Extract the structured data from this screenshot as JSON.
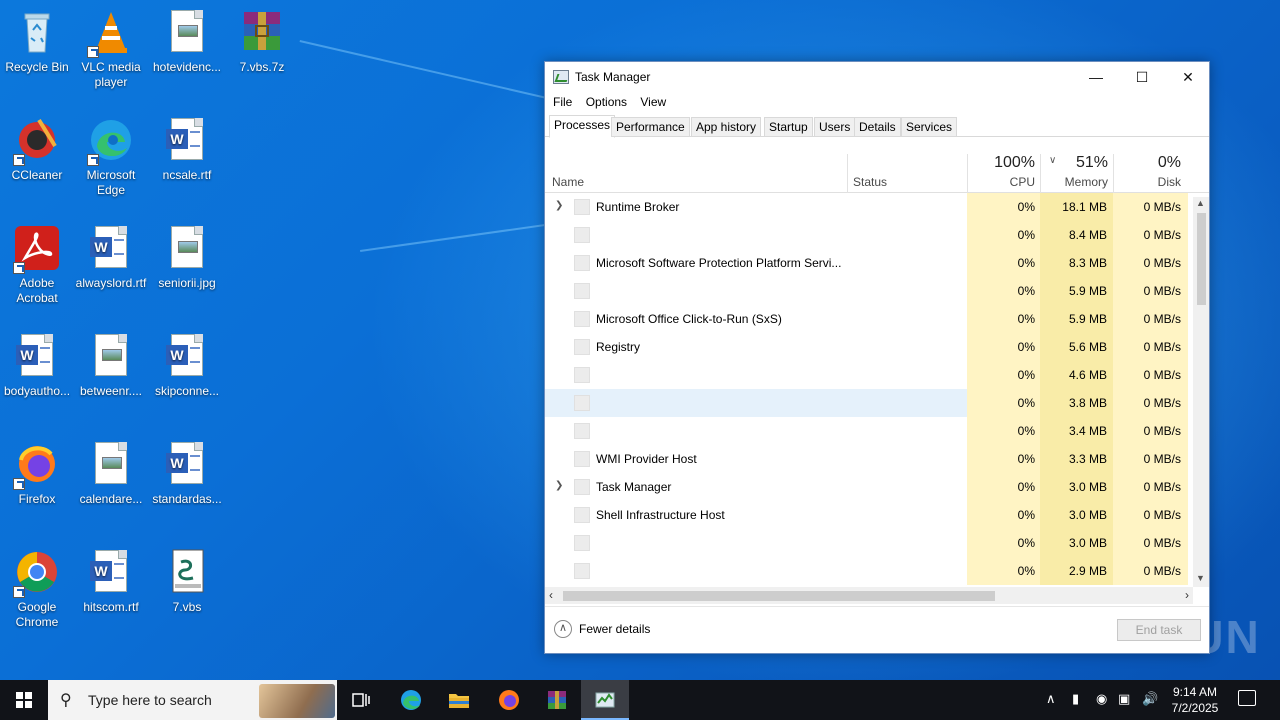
{
  "desktop_icons": [
    {
      "label": "Recycle Bin"
    },
    {
      "label": "VLC media player"
    },
    {
      "label": "hotevidenc..."
    },
    {
      "label": "7.vbs.7z"
    },
    {
      "label": "CCleaner"
    },
    {
      "label": "Microsoft Edge"
    },
    {
      "label": "ncsale.rtf"
    },
    {
      "label": "Adobe Acrobat"
    },
    {
      "label": "alwayslord.rtf"
    },
    {
      "label": "seniorii.jpg"
    },
    {
      "label": "bodyautho..."
    },
    {
      "label": "betweenr...."
    },
    {
      "label": "skipconne..."
    },
    {
      "label": "Firefox"
    },
    {
      "label": "calendare..."
    },
    {
      "label": "standardas..."
    },
    {
      "label": "Google Chrome"
    },
    {
      "label": "hitscom.rtf"
    },
    {
      "label": "7.vbs"
    }
  ],
  "window": {
    "title": "Task Manager",
    "minimize": "—",
    "maximize": "☐",
    "close": "✕"
  },
  "menu": [
    "File",
    "Options",
    "View"
  ],
  "tabs": [
    "Processes",
    "Performance",
    "App history",
    "Startup",
    "Users",
    "Details",
    "Services"
  ],
  "columns": {
    "name": "Name",
    "status": "Status",
    "cpu_pct": "100%",
    "cpu": "CPU",
    "memory_pct": "51%",
    "memory": "Memory",
    "disk_pct": "0%",
    "disk": "Disk"
  },
  "processes": [
    {
      "name": "Runtime Broker",
      "expandable": true,
      "cpu": "0%",
      "memory": "18.1 MB",
      "disk": "0 MB/s"
    },
    {
      "name": "",
      "expandable": false,
      "cpu": "0%",
      "memory": "8.4 MB",
      "disk": "0 MB/s"
    },
    {
      "name": "Microsoft Software Protection Platform Servi...",
      "expandable": false,
      "cpu": "0%",
      "memory": "8.3 MB",
      "disk": "0 MB/s"
    },
    {
      "name": "",
      "expandable": false,
      "cpu": "0%",
      "memory": "5.9 MB",
      "disk": "0 MB/s"
    },
    {
      "name": "Microsoft Office Click-to-Run (SxS)",
      "expandable": false,
      "cpu": "0%",
      "memory": "5.9 MB",
      "disk": "0 MB/s"
    },
    {
      "name": "Registry",
      "expandable": false,
      "cpu": "0%",
      "memory": "5.6 MB",
      "disk": "0 MB/s"
    },
    {
      "name": "",
      "expandable": false,
      "cpu": "0%",
      "memory": "4.6 MB",
      "disk": "0 MB/s"
    },
    {
      "name": "",
      "expandable": false,
      "cpu": "0%",
      "memory": "3.8 MB",
      "disk": "0 MB/s",
      "selected": true
    },
    {
      "name": "",
      "expandable": false,
      "cpu": "0%",
      "memory": "3.4 MB",
      "disk": "0 MB/s"
    },
    {
      "name": "WMI Provider Host",
      "expandable": false,
      "cpu": "0%",
      "memory": "3.3 MB",
      "disk": "0 MB/s"
    },
    {
      "name": "Task Manager",
      "expandable": true,
      "cpu": "0%",
      "memory": "3.0 MB",
      "disk": "0 MB/s"
    },
    {
      "name": "Shell Infrastructure Host",
      "expandable": false,
      "cpu": "0%",
      "memory": "3.0 MB",
      "disk": "0 MB/s"
    },
    {
      "name": "",
      "expandable": false,
      "cpu": "0%",
      "memory": "3.0 MB",
      "disk": "0 MB/s"
    },
    {
      "name": "",
      "expandable": false,
      "cpu": "0%",
      "memory": "2.9 MB",
      "disk": "0 MB/s"
    }
  ],
  "footer": {
    "fewer_details": "Fewer details",
    "end_task": "End task"
  },
  "watermark": "ANY RUN",
  "taskbar": {
    "search_placeholder": "Type here to search",
    "time": "9:14 AM",
    "date": "7/2/2025"
  },
  "colors": {
    "accent": "#0a63c9",
    "cpu_highlight": "#fff4c4",
    "memory_highlight": "#f9eca8",
    "selection": "#e5f1fb"
  }
}
